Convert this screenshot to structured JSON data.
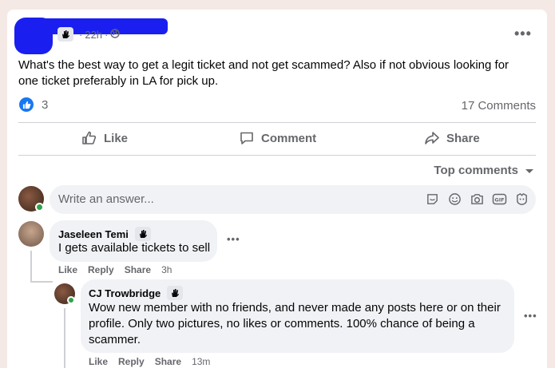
{
  "post": {
    "time": "22h",
    "separator": "·",
    "text": "What's the best way to get a legit ticket and not get scammed? Also if not obvious looking for one ticket preferably in LA for pick up.",
    "reaction_count": "3",
    "comment_count": "17 Comments"
  },
  "actions": {
    "like": "Like",
    "comment": "Comment",
    "share": "Share"
  },
  "sort": {
    "label": "Top comments"
  },
  "composer": {
    "placeholder": "Write an answer..."
  },
  "comments": [
    {
      "name": "Jaseleen Temi",
      "text": "I gets available tickets to sell",
      "like": "Like",
      "reply": "Reply",
      "share": "Share",
      "time": "3h"
    },
    {
      "name": "CJ Trowbridge",
      "text": "Wow new member with no friends, and never made any posts here or on their profile. Only two pictures, no likes or comments. 100% chance of being a scammer.",
      "like": "Like",
      "reply": "Reply",
      "share": "Share",
      "time": "13m"
    }
  ],
  "colors": {
    "brand_blue": "#1877f2",
    "online_green": "#31a24c",
    "redaction": "#1a1ff0"
  },
  "icons": [
    "waving-hand-icon",
    "globe-icon",
    "like-thumb-icon",
    "comment-icon",
    "share-icon",
    "caret-down-icon",
    "sticker-icon",
    "emoji-icon",
    "camera-icon",
    "gif-icon",
    "avatar-sticker-icon",
    "more-options-icon"
  ]
}
